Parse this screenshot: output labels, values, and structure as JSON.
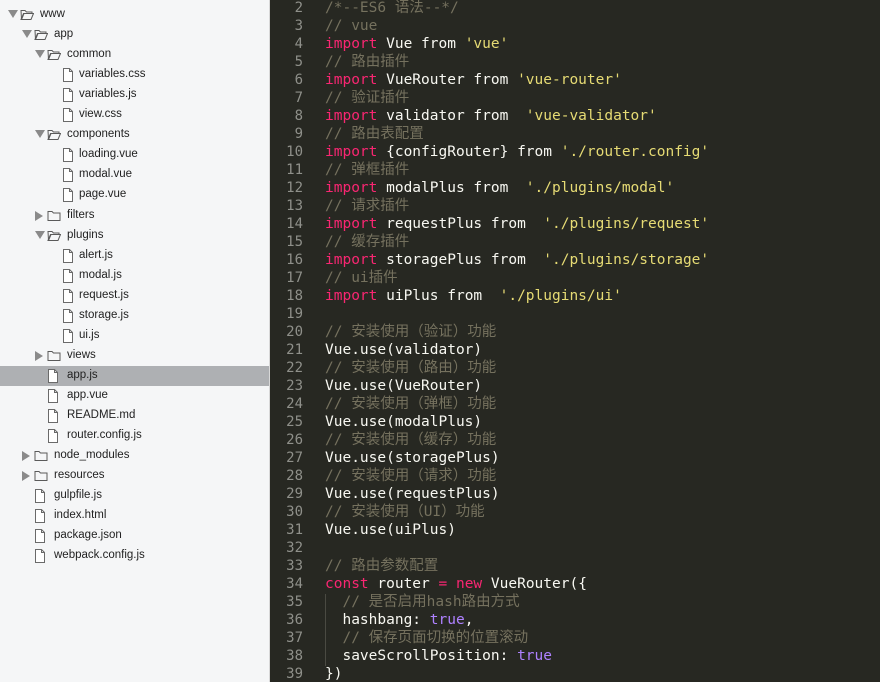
{
  "sidebar": {
    "items": [
      {
        "label": "www",
        "type": "folder",
        "state": "open",
        "depth": 0,
        "selected": false
      },
      {
        "label": "app",
        "type": "folder",
        "state": "open",
        "depth": 1,
        "selected": false
      },
      {
        "label": "common",
        "type": "folder",
        "state": "open",
        "depth": 2,
        "selected": false
      },
      {
        "label": "variables.css",
        "type": "file",
        "depth": 3,
        "selected": false
      },
      {
        "label": "variables.js",
        "type": "file",
        "depth": 3,
        "selected": false
      },
      {
        "label": "view.css",
        "type": "file",
        "depth": 3,
        "selected": false
      },
      {
        "label": "components",
        "type": "folder",
        "state": "open",
        "depth": 2,
        "selected": false
      },
      {
        "label": "loading.vue",
        "type": "file",
        "depth": 3,
        "selected": false
      },
      {
        "label": "modal.vue",
        "type": "file",
        "depth": 3,
        "selected": false
      },
      {
        "label": "page.vue",
        "type": "file",
        "depth": 3,
        "selected": false
      },
      {
        "label": "filters",
        "type": "folder",
        "state": "closed",
        "depth": 2,
        "selected": false
      },
      {
        "label": "plugins",
        "type": "folder",
        "state": "open",
        "depth": 2,
        "selected": false
      },
      {
        "label": "alert.js",
        "type": "file",
        "depth": 3,
        "selected": false
      },
      {
        "label": "modal.js",
        "type": "file",
        "depth": 3,
        "selected": false
      },
      {
        "label": "request.js",
        "type": "file",
        "depth": 3,
        "selected": false
      },
      {
        "label": "storage.js",
        "type": "file",
        "depth": 3,
        "selected": false
      },
      {
        "label": "ui.js",
        "type": "file",
        "depth": 3,
        "selected": false
      },
      {
        "label": "views",
        "type": "folder",
        "state": "closed",
        "depth": 2,
        "selected": false
      },
      {
        "label": "app.js",
        "type": "file",
        "depth": 2,
        "selected": true
      },
      {
        "label": "app.vue",
        "type": "file",
        "depth": 2,
        "selected": false
      },
      {
        "label": "README.md",
        "type": "file",
        "depth": 2,
        "selected": false
      },
      {
        "label": "router.config.js",
        "type": "file",
        "depth": 2,
        "selected": false
      },
      {
        "label": "node_modules",
        "type": "folder",
        "state": "closed",
        "depth": 1,
        "selected": false
      },
      {
        "label": "resources",
        "type": "folder",
        "state": "closed",
        "depth": 1,
        "selected": false
      },
      {
        "label": "gulpfile.js",
        "type": "file",
        "depth": 1,
        "selected": false
      },
      {
        "label": "index.html",
        "type": "file",
        "depth": 1,
        "selected": false
      },
      {
        "label": "package.json",
        "type": "file",
        "depth": 1,
        "selected": false
      },
      {
        "label": "webpack.config.js",
        "type": "file",
        "depth": 1,
        "selected": false
      }
    ]
  },
  "editor": {
    "lines": [
      {
        "n": "2",
        "tokens": [
          [
            "cmt",
            "/*--ES6 语法--*/"
          ]
        ]
      },
      {
        "n": "3",
        "tokens": [
          [
            "cmt",
            "// vue"
          ]
        ]
      },
      {
        "n": "4",
        "tokens": [
          [
            "kw",
            "import"
          ],
          [
            "id",
            " Vue from "
          ],
          [
            "str",
            "'vue'"
          ]
        ]
      },
      {
        "n": "5",
        "tokens": [
          [
            "cmt",
            "// 路由插件"
          ]
        ]
      },
      {
        "n": "6",
        "tokens": [
          [
            "kw",
            "import"
          ],
          [
            "id",
            " VueRouter from "
          ],
          [
            "str",
            "'vue-router'"
          ]
        ]
      },
      {
        "n": "7",
        "tokens": [
          [
            "cmt",
            "// 验证插件"
          ]
        ]
      },
      {
        "n": "8",
        "tokens": [
          [
            "kw",
            "import"
          ],
          [
            "id",
            " validator from  "
          ],
          [
            "str",
            "'vue-validator'"
          ]
        ]
      },
      {
        "n": "9",
        "tokens": [
          [
            "cmt",
            "// 路由表配置"
          ]
        ]
      },
      {
        "n": "10",
        "tokens": [
          [
            "kw",
            "import"
          ],
          [
            "id",
            " {configRouter} from "
          ],
          [
            "str",
            "'./router.config'"
          ]
        ]
      },
      {
        "n": "11",
        "tokens": [
          [
            "cmt",
            "// 弹框插件"
          ]
        ]
      },
      {
        "n": "12",
        "tokens": [
          [
            "kw",
            "import"
          ],
          [
            "id",
            " modalPlus from  "
          ],
          [
            "str",
            "'./plugins/modal'"
          ]
        ]
      },
      {
        "n": "13",
        "tokens": [
          [
            "cmt",
            "// 请求插件"
          ]
        ]
      },
      {
        "n": "14",
        "tokens": [
          [
            "kw",
            "import"
          ],
          [
            "id",
            " requestPlus from  "
          ],
          [
            "str",
            "'./plugins/request'"
          ]
        ]
      },
      {
        "n": "15",
        "tokens": [
          [
            "cmt",
            "// 缓存插件"
          ]
        ]
      },
      {
        "n": "16",
        "tokens": [
          [
            "kw",
            "import"
          ],
          [
            "id",
            " storagePlus from  "
          ],
          [
            "str",
            "'./plugins/storage'"
          ]
        ]
      },
      {
        "n": "17",
        "tokens": [
          [
            "cmt",
            "// ui插件"
          ]
        ]
      },
      {
        "n": "18",
        "tokens": [
          [
            "kw",
            "import"
          ],
          [
            "id",
            " uiPlus from  "
          ],
          [
            "str",
            "'./plugins/ui'"
          ]
        ]
      },
      {
        "n": "19",
        "tokens": []
      },
      {
        "n": "20",
        "tokens": [
          [
            "cmt",
            "// 安装使用（验证）功能"
          ]
        ]
      },
      {
        "n": "21",
        "tokens": [
          [
            "id",
            "Vue.use(validator)"
          ]
        ]
      },
      {
        "n": "22",
        "tokens": [
          [
            "cmt",
            "// 安装使用（路由）功能"
          ]
        ]
      },
      {
        "n": "23",
        "tokens": [
          [
            "id",
            "Vue.use(VueRouter)"
          ]
        ]
      },
      {
        "n": "24",
        "tokens": [
          [
            "cmt",
            "// 安装使用（弹框）功能"
          ]
        ]
      },
      {
        "n": "25",
        "tokens": [
          [
            "id",
            "Vue.use(modalPlus)"
          ]
        ]
      },
      {
        "n": "26",
        "tokens": [
          [
            "cmt",
            "// 安装使用（缓存）功能"
          ]
        ]
      },
      {
        "n": "27",
        "tokens": [
          [
            "id",
            "Vue.use(storagePlus)"
          ]
        ]
      },
      {
        "n": "28",
        "tokens": [
          [
            "cmt",
            "// 安装使用（请求）功能"
          ]
        ]
      },
      {
        "n": "29",
        "tokens": [
          [
            "id",
            "Vue.use(requestPlus)"
          ]
        ]
      },
      {
        "n": "30",
        "tokens": [
          [
            "cmt",
            "// 安装使用（UI）功能"
          ]
        ]
      },
      {
        "n": "31",
        "tokens": [
          [
            "id",
            "Vue.use(uiPlus)"
          ]
        ]
      },
      {
        "n": "32",
        "tokens": []
      },
      {
        "n": "33",
        "tokens": [
          [
            "cmt",
            "// 路由参数配置"
          ]
        ]
      },
      {
        "n": "34",
        "tokens": [
          [
            "kw",
            "const"
          ],
          [
            "id",
            " router "
          ],
          [
            "kw",
            "="
          ],
          [
            "id",
            " "
          ],
          [
            "kw",
            "new"
          ],
          [
            "id",
            " VueRouter({"
          ]
        ]
      },
      {
        "n": "35",
        "tokens": [
          [
            "id",
            "  "
          ],
          [
            "cmt",
            "// 是否启用hash路由方式"
          ]
        ]
      },
      {
        "n": "36",
        "tokens": [
          [
            "id",
            "  hashbang: "
          ],
          [
            "const",
            "true"
          ],
          [
            "id",
            ","
          ]
        ]
      },
      {
        "n": "37",
        "tokens": [
          [
            "id",
            "  "
          ],
          [
            "cmt",
            "// 保存页面切换的位置滚动"
          ]
        ]
      },
      {
        "n": "38",
        "tokens": [
          [
            "id",
            "  saveScrollPosition: "
          ],
          [
            "const",
            "true"
          ]
        ]
      },
      {
        "n": "39",
        "tokens": [
          [
            "id",
            "})"
          ]
        ]
      }
    ]
  },
  "colors": {
    "editor_bg": "#272822",
    "comment": "#75715e",
    "keyword": "#f92672",
    "string": "#e6db74",
    "identifier": "#f8f8f2",
    "constant": "#ae81ff",
    "selection": "#aeb0b3"
  }
}
